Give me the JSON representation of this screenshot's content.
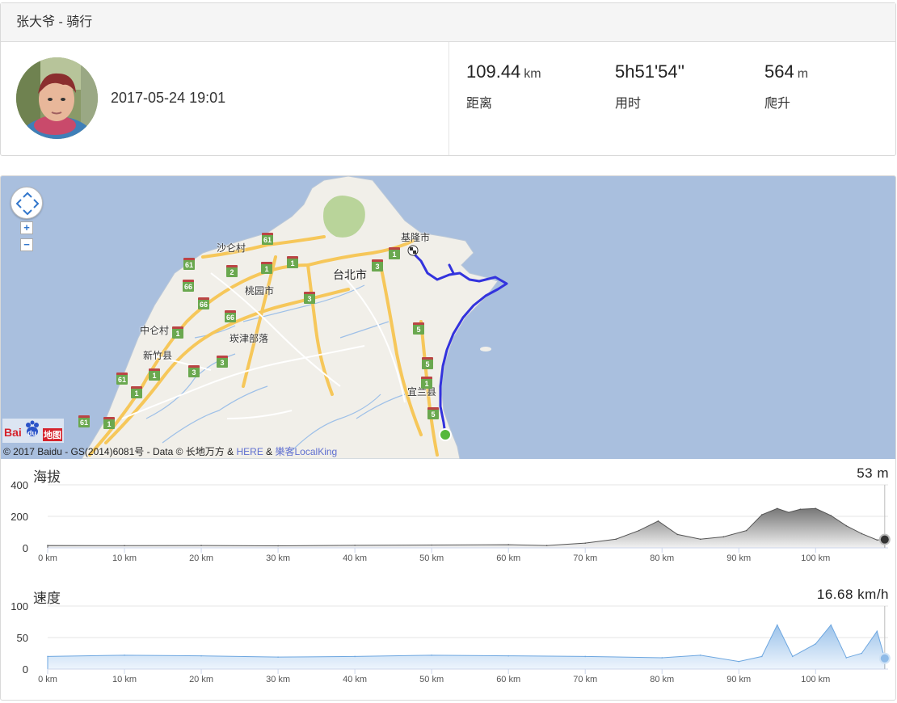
{
  "header": {
    "title": "张大爷 - 骑行"
  },
  "activity": {
    "datetime": "2017-05-24 19:01",
    "avatar_icon": "user-avatar"
  },
  "stats": [
    {
      "value": "109.44",
      "unit": "km",
      "label": "距离"
    },
    {
      "value": "5h51'54''",
      "unit": "",
      "label": "用时"
    },
    {
      "value": "564",
      "unit": "m",
      "label": "爬升"
    }
  ],
  "map": {
    "zoom_in": "+",
    "zoom_out": "−",
    "logo": {
      "text1": "Bai",
      "text2": "du",
      "text3": "地图"
    },
    "copyright_a": "© 2017 Baidu - GS(2014)6081号 - Data © 长地万方 & ",
    "copyright_here": "HERE",
    "copyright_amp": " & ",
    "copyright_lk": "樂客LocalKing",
    "labels": [
      "沙仑村",
      "台北市",
      "桃园市",
      "中仑村",
      "新竹县",
      "崁津部落",
      "基隆市",
      "宜兰县"
    ],
    "route_shields": [
      "61",
      "61",
      "66",
      "66",
      "66",
      "1",
      "1",
      "1",
      "1",
      "1",
      "1",
      "2",
      "3",
      "3",
      "3",
      "3",
      "1",
      "61",
      "61",
      "5",
      "5",
      "5",
      "1"
    ]
  },
  "elevation": {
    "title": "海拔",
    "current": "53 m"
  },
  "speed": {
    "title": "速度",
    "current": "16.68 km/h"
  },
  "chart_data": [
    {
      "type": "area",
      "title": "海拔",
      "xlabel": "",
      "ylabel": "",
      "x_ticks": [
        "0 km",
        "10 km",
        "20 km",
        "30 km",
        "40 km",
        "50 km",
        "60 km",
        "70 km",
        "80 km",
        "90 km",
        "100 km"
      ],
      "y_ticks": [
        "400",
        "200",
        "0"
      ],
      "ylim": [
        0,
        400
      ],
      "xlim": [
        0,
        109.44
      ],
      "x": [
        0,
        10,
        20,
        30,
        40,
        50,
        60,
        65,
        70,
        74,
        77,
        79.5,
        82,
        85,
        88,
        91,
        93,
        95,
        96.5,
        98,
        100,
        102,
        104,
        106,
        108,
        109
      ],
      "values": [
        15,
        14,
        15,
        13,
        16,
        18,
        20,
        15,
        30,
        55,
        110,
        170,
        85,
        55,
        70,
        110,
        210,
        250,
        225,
        245,
        250,
        205,
        140,
        90,
        50,
        53
      ],
      "grid": true
    },
    {
      "type": "area",
      "title": "速度",
      "xlabel": "",
      "ylabel": "",
      "x_ticks": [
        "0 km",
        "10 km",
        "20 km",
        "30 km",
        "40 km",
        "50 km",
        "60 km",
        "70 km",
        "80 km",
        "90 km",
        "100 km"
      ],
      "y_ticks": [
        "100",
        "50",
        "0"
      ],
      "ylim": [
        0,
        100
      ],
      "xlim": [
        0,
        109.44
      ],
      "x": [
        0,
        10,
        20,
        30,
        40,
        50,
        60,
        70,
        80,
        85,
        90,
        93,
        95,
        97,
        100,
        102,
        104,
        106,
        108,
        109
      ],
      "values": [
        20,
        22,
        21,
        19,
        20,
        22,
        21,
        20,
        18,
        22,
        12,
        20,
        70,
        20,
        40,
        70,
        18,
        25,
        60,
        17
      ],
      "grid": true
    }
  ]
}
